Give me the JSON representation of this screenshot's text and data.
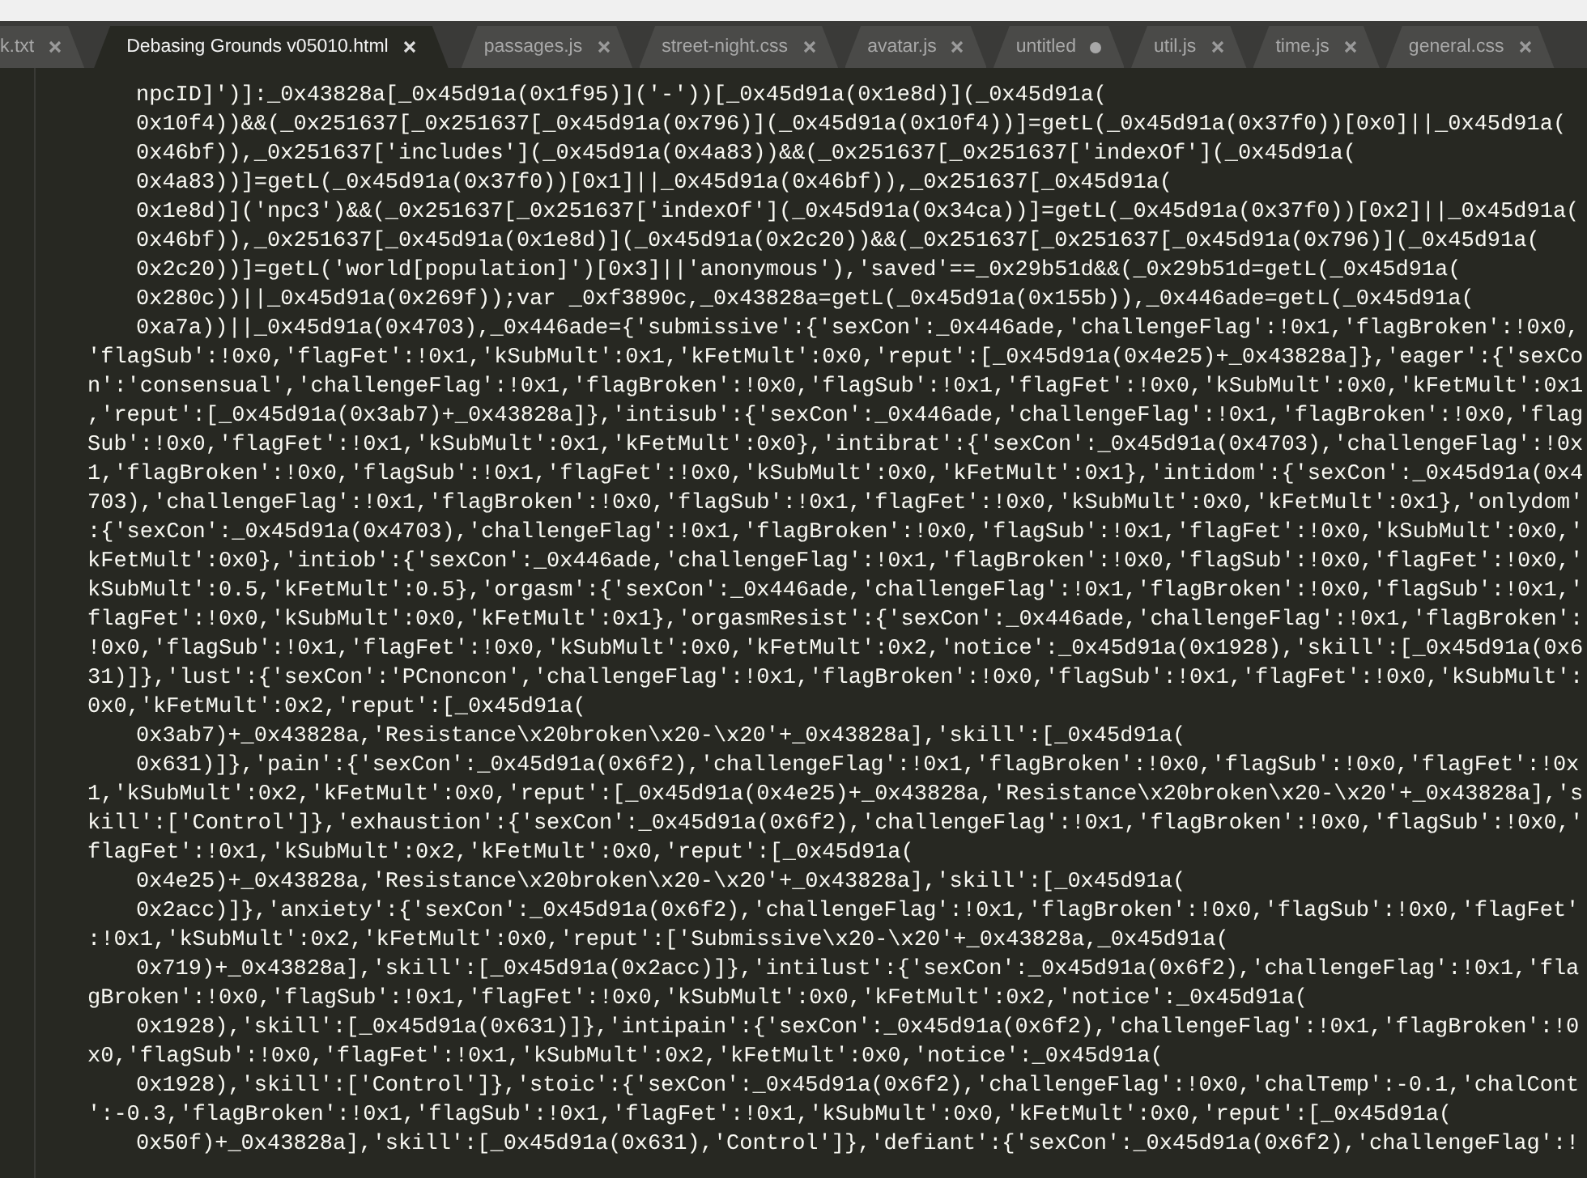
{
  "tabs": [
    {
      "label": "k.txt",
      "selected": false,
      "modified": false
    },
    {
      "label": "Debasing Grounds v05010.html",
      "selected": true,
      "modified": false
    },
    {
      "label": "passages.js",
      "selected": false,
      "modified": false
    },
    {
      "label": "street-night.css",
      "selected": false,
      "modified": false
    },
    {
      "label": "avatar.js",
      "selected": false,
      "modified": false
    },
    {
      "label": "untitled",
      "selected": false,
      "modified": true
    },
    {
      "label": "util.js",
      "selected": false,
      "modified": false
    },
    {
      "label": "time.js",
      "selected": false,
      "modified": false
    },
    {
      "label": "general.css",
      "selected": false,
      "modified": false
    }
  ],
  "code_lines": [
    {
      "text": "npcID]')]:_0x43828a[_0x45d91a(0x1f95)]('-'))[_0x45d91a(0x1e8d)](_0x45d91a(",
      "indented": true
    },
    {
      "text": "0x10f4))&&(_0x251637[_0x251637[_0x45d91a(0x796)](_0x45d91a(0x10f4))]=getL(_0x45d91a(0x37f0))[0x0]||_0x45d91a(",
      "indented": true
    },
    {
      "text": "0x46bf)),_0x251637['includes'](_0x45d91a(0x4a83))&&(_0x251637[_0x251637['indexOf'](_0x45d91a(",
      "indented": true
    },
    {
      "text": "0x4a83))]=getL(_0x45d91a(0x37f0))[0x1]||_0x45d91a(0x46bf)),_0x251637[_0x45d91a(",
      "indented": true
    },
    {
      "text": "0x1e8d)]('npc3')&&(_0x251637[_0x251637['indexOf'](_0x45d91a(0x34ca))]=getL(_0x45d91a(0x37f0))[0x2]||_0x45d91a(",
      "indented": true
    },
    {
      "text": "0x46bf)),_0x251637[_0x45d91a(0x1e8d)](_0x45d91a(0x2c20))&&(_0x251637[_0x251637[_0x45d91a(0x796)](_0x45d91a(",
      "indented": true
    },
    {
      "text": "0x2c20))]=getL('world[population]')[0x3]||'anonymous'),'saved'==_0x29b51d&&(_0x29b51d=getL(_0x45d91a(",
      "indented": true
    },
    {
      "text": "0x280c))||_0x45d91a(0x269f));var _0xf3890c,_0x43828a=getL(_0x45d91a(0x155b)),_0x446ade=getL(_0x45d91a(",
      "indented": true
    },
    {
      "text": "0xa7a))||_0x45d91a(0x4703),_0x446ade={'submissive':{'sexCon':_0x446ade,'challengeFlag':!0x1,'flagBroken':!0x0,",
      "indented": true
    },
    {
      "text": "'flagSub':!0x0,'flagFet':!0x1,'kSubMult':0x1,'kFetMult':0x0,'reput':[_0x45d91a(0x4e25)+_0x43828a]},'eager':{'sexCo",
      "indented": false
    },
    {
      "text": "n':'consensual','challengeFlag':!0x1,'flagBroken':!0x0,'flagSub':!0x1,'flagFet':!0x0,'kSubMult':0x0,'kFetMult':0x1",
      "indented": false
    },
    {
      "text": ",'reput':[_0x45d91a(0x3ab7)+_0x43828a]},'intisub':{'sexCon':_0x446ade,'challengeFlag':!0x1,'flagBroken':!0x0,'flag",
      "indented": false
    },
    {
      "text": "Sub':!0x0,'flagFet':!0x1,'kSubMult':0x1,'kFetMult':0x0},'intibrat':{'sexCon':_0x45d91a(0x4703),'challengeFlag':!0x",
      "indented": false
    },
    {
      "text": "1,'flagBroken':!0x0,'flagSub':!0x1,'flagFet':!0x0,'kSubMult':0x0,'kFetMult':0x1},'intidom':{'sexCon':_0x45d91a(0x4",
      "indented": false
    },
    {
      "text": "703),'challengeFlag':!0x1,'flagBroken':!0x0,'flagSub':!0x1,'flagFet':!0x0,'kSubMult':0x0,'kFetMult':0x1},'onlydom'",
      "indented": false
    },
    {
      "text": ":{'sexCon':_0x45d91a(0x4703),'challengeFlag':!0x1,'flagBroken':!0x0,'flagSub':!0x1,'flagFet':!0x0,'kSubMult':0x0,'",
      "indented": false
    },
    {
      "text": "kFetMult':0x0},'intiob':{'sexCon':_0x446ade,'challengeFlag':!0x1,'flagBroken':!0x0,'flagSub':!0x0,'flagFet':!0x0,'",
      "indented": false
    },
    {
      "text": "kSubMult':0.5,'kFetMult':0.5},'orgasm':{'sexCon':_0x446ade,'challengeFlag':!0x1,'flagBroken':!0x0,'flagSub':!0x1,'",
      "indented": false
    },
    {
      "text": "flagFet':!0x0,'kSubMult':0x0,'kFetMult':0x1},'orgasmResist':{'sexCon':_0x446ade,'challengeFlag':!0x1,'flagBroken':",
      "indented": false
    },
    {
      "text": "!0x0,'flagSub':!0x1,'flagFet':!0x0,'kSubMult':0x0,'kFetMult':0x2,'notice':_0x45d91a(0x1928),'skill':[_0x45d91a(0x6",
      "indented": false
    },
    {
      "text": "31)]},'lust':{'sexCon':'PCnoncon','challengeFlag':!0x1,'flagBroken':!0x0,'flagSub':!0x1,'flagFet':!0x0,'kSubMult':",
      "indented": false
    },
    {
      "text": "0x0,'kFetMult':0x2,'reput':[_0x45d91a(",
      "indented": false
    },
    {
      "text": "0x3ab7)+_0x43828a,'Resistance\\x20broken\\x20-\\x20'+_0x43828a],'skill':[_0x45d91a(",
      "indented": true
    },
    {
      "text": "0x631)]},'pain':{'sexCon':_0x45d91a(0x6f2),'challengeFlag':!0x1,'flagBroken':!0x0,'flagSub':!0x0,'flagFet':!0x",
      "indented": true
    },
    {
      "text": "1,'kSubMult':0x2,'kFetMult':0x0,'reput':[_0x45d91a(0x4e25)+_0x43828a,'Resistance\\x20broken\\x20-\\x20'+_0x43828a],'s",
      "indented": false
    },
    {
      "text": "kill':['Control']},'exhaustion':{'sexCon':_0x45d91a(0x6f2),'challengeFlag':!0x1,'flagBroken':!0x0,'flagSub':!0x0,'",
      "indented": false
    },
    {
      "text": "flagFet':!0x1,'kSubMult':0x2,'kFetMult':0x0,'reput':[_0x45d91a(",
      "indented": false
    },
    {
      "text": "0x4e25)+_0x43828a,'Resistance\\x20broken\\x20-\\x20'+_0x43828a],'skill':[_0x45d91a(",
      "indented": true
    },
    {
      "text": "0x2acc)]},'anxiety':{'sexCon':_0x45d91a(0x6f2),'challengeFlag':!0x1,'flagBroken':!0x0,'flagSub':!0x0,'flagFet'",
      "indented": true
    },
    {
      "text": ":!0x1,'kSubMult':0x2,'kFetMult':0x0,'reput':['Submissive\\x20-\\x20'+_0x43828a,_0x45d91a(",
      "indented": false
    },
    {
      "text": "0x719)+_0x43828a],'skill':[_0x45d91a(0x2acc)]},'intilust':{'sexCon':_0x45d91a(0x6f2),'challengeFlag':!0x1,'fla",
      "indented": true
    },
    {
      "text": "gBroken':!0x0,'flagSub':!0x1,'flagFet':!0x0,'kSubMult':0x0,'kFetMult':0x2,'notice':_0x45d91a(",
      "indented": false
    },
    {
      "text": "0x1928),'skill':[_0x45d91a(0x631)]},'intipain':{'sexCon':_0x45d91a(0x6f2),'challengeFlag':!0x1,'flagBroken':!0",
      "indented": true
    },
    {
      "text": "x0,'flagSub':!0x0,'flagFet':!0x1,'kSubMult':0x2,'kFetMult':0x0,'notice':_0x45d91a(",
      "indented": false
    },
    {
      "text": "0x1928),'skill':['Control']},'stoic':{'sexCon':_0x45d91a(0x6f2),'challengeFlag':!0x0,'chalTemp':-0.1,'chalCont",
      "indented": true
    },
    {
      "text": "':-0.3,'flagBroken':!0x1,'flagSub':!0x1,'flagFet':!0x1,'kSubMult':0x0,'kFetMult':0x0,'reput':[_0x45d91a(",
      "indented": false
    },
    {
      "text": "0x50f)+_0x43828a],'skill':[_0x45d91a(0x631),'Control']},'defiant':{'sexCon':_0x45d91a(0x6f2),'challengeFlag':!",
      "indented": true
    }
  ]
}
